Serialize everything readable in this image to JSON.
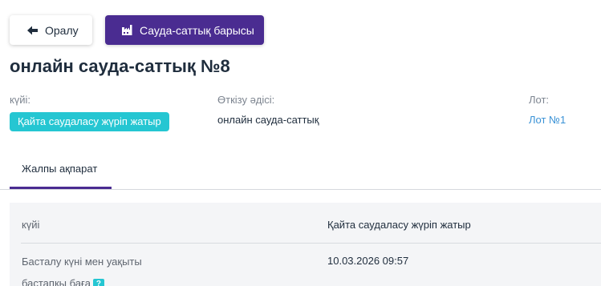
{
  "toolbar": {
    "back_label": "Оралу",
    "progress_label": "Сауда-саттық барысы"
  },
  "page_title": "онлайн сауда-саттық №8",
  "summary": {
    "status_label": "күйі:",
    "status_value": "Қайта саудаласу жүріп жатыр",
    "method_label": "Өткізу әдісі:",
    "method_value": "онлайн сауда-саттық",
    "lot_label": "Лот:",
    "lot_value": "Лот №1"
  },
  "tabs": [
    {
      "label": "Жалпы ақпарат",
      "active": true
    }
  ],
  "info": {
    "rows": [
      {
        "label": "күйі",
        "value": "Қайта саудаласу жүріп жатыр"
      },
      {
        "label": "Басталу күні мен уақыты",
        "value": "10.03.2026 09:57"
      },
      {
        "label": "бастапқы баға",
        "value": "",
        "hint": "?"
      }
    ]
  },
  "colors": {
    "primary": "#4a2c91",
    "status": "#25c6d2",
    "link": "#3a92d6"
  },
  "icons": {
    "back": "arrow-left-icon",
    "progress": "factory-icon"
  }
}
